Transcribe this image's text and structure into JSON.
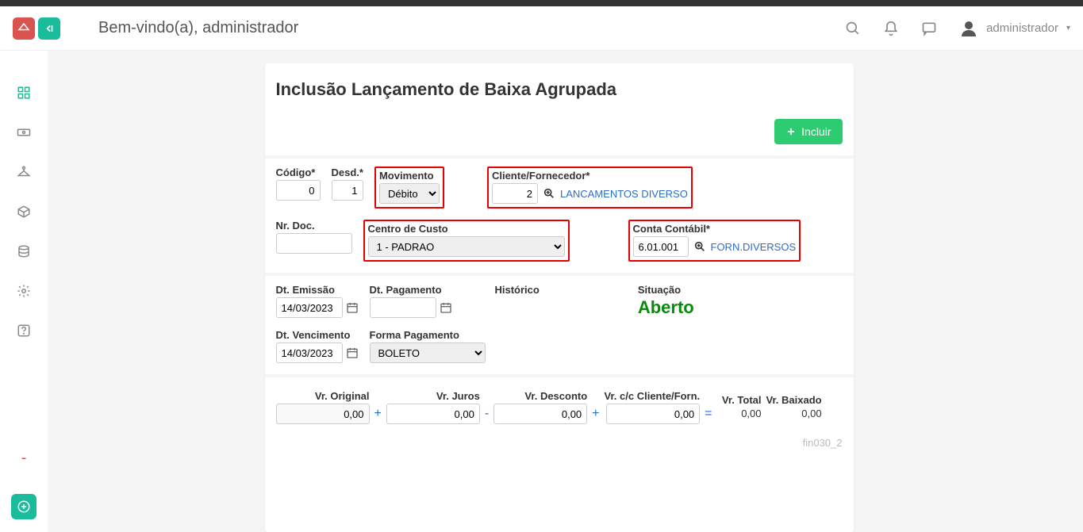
{
  "header": {
    "welcome": "Bem-vindo(a), administrador",
    "user": "administrador"
  },
  "page": {
    "title": "Inclusão Lançamento de Baixa Agrupada",
    "include_btn": "Incluir",
    "footer_id": "fin030_2"
  },
  "labels": {
    "codigo": "Código*",
    "desd": "Desd.*",
    "movimento": "Movimento",
    "cliente_fornecedor": "Cliente/Fornecedor*",
    "nr_doc": "Nr. Doc.",
    "centro_custo": "Centro de Custo",
    "conta_contabil": "Conta Contábil*",
    "dt_emissao": "Dt. Emissão",
    "dt_pagamento": "Dt. Pagamento",
    "historico": "Histórico",
    "situacao": "Situação",
    "dt_vencimento": "Dt. Vencimento",
    "forma_pagamento": "Forma Pagamento",
    "vr_original": "Vr. Original",
    "vr_juros": "Vr. Juros",
    "vr_desconto": "Vr. Desconto",
    "vr_cc": "Vr. c/c Cliente/Forn.",
    "vr_total": "Vr. Total",
    "vr_baixado": "Vr. Baixado"
  },
  "values": {
    "codigo": "0",
    "desd": "1",
    "movimento": "Débito",
    "cliente_id": "2",
    "cliente_name": "LANCAMENTOS DIVERSO",
    "nr_doc": "",
    "centro_custo": "1 - PADRAO",
    "conta_code": "6.01.001",
    "conta_name": "FORN.DIVERSOS",
    "dt_emissao": "14/03/2023",
    "dt_pagamento": "",
    "dt_vencimento": "14/03/2023",
    "forma_pagamento": "BOLETO",
    "situacao": "Aberto",
    "vr_original": "0,00",
    "vr_juros": "0,00",
    "vr_desconto": "0,00",
    "vr_cc": "0,00",
    "vr_total": "0,00",
    "vr_baixado": "0,00"
  }
}
